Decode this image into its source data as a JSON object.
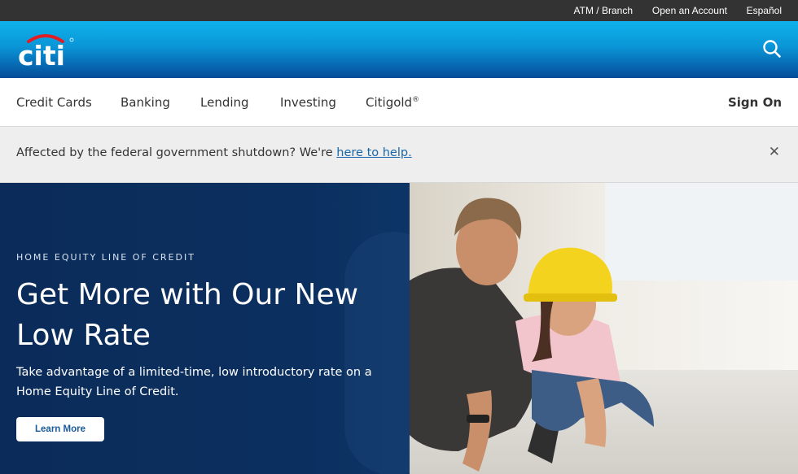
{
  "utility_nav": {
    "atm_branch": "ATM / Branch",
    "open_account": "Open an Account",
    "espanol": "Español"
  },
  "brand": {
    "logo_text": "citi",
    "colors": {
      "header_top": "#0fb2ec",
      "header_bottom": "#054b98",
      "logo_arc": "#e31b23",
      "hero_panel": "#0b2c5a"
    }
  },
  "main_nav": {
    "items": [
      {
        "label": "Credit Cards"
      },
      {
        "label": "Banking"
      },
      {
        "label": "Lending"
      },
      {
        "label": "Investing"
      },
      {
        "label": "Citigold",
        "superscript": "®"
      }
    ],
    "sign_on": "Sign On"
  },
  "alert": {
    "text": "Affected by the federal government shutdown? We're ",
    "link_text": "here to help.",
    "close_icon": "close-icon"
  },
  "hero": {
    "eyebrow": "HOME EQUITY LINE OF CREDIT",
    "headline": "Get More with Our New Low Rate",
    "body": "Take advantage of a limited-time, low introductory rate on a Home Equity Line of Credit.",
    "cta": "Learn More",
    "image_description_icon": "photo-man-and-child-hardhat"
  }
}
